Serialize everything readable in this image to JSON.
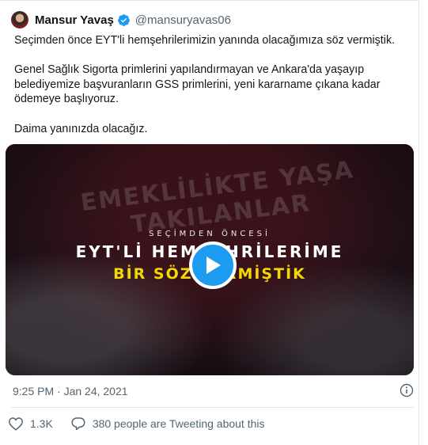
{
  "tweet": {
    "author": {
      "display_name": "Mansur Yavaş",
      "handle": "@mansuryavas06",
      "verified": true
    },
    "paragraphs": [
      "Seçimden önce EYT'li hemşehrilerimizin yanında olacağımıza söz vermiştik.",
      "Genel Sağlık Sigorta primlerini yapılandırmayan ve Ankara'da yaşayıp\nbelediyemize başvuranların GSS primlerini, yeni kararname çıkana kadar\nödemeye başlıyoruz.",
      "Daima yanınızda olacağız."
    ],
    "timestamp": "9:25 PM · Jan 24, 2021",
    "likes": "1.3K",
    "conversation": "380 people are Tweeting about this"
  },
  "video": {
    "banner_text": "EMEKLİLİKTE YAŞA TAKILANLAR",
    "line1": "SEÇİMDEN ÖNCESİ",
    "line2": "EYT'Lİ HEMŞEHRİLERİME",
    "line3": "BİR SÖZ VERMİŞTİK"
  },
  "colors": {
    "accent": "#1d9bf0",
    "secondary_text": "#536471",
    "highlight_yellow": "#f5d800"
  },
  "icons": {
    "verified": "verified-badge-icon",
    "play": "play-icon",
    "info": "info-icon",
    "like": "heart-icon",
    "conversation": "speech-bubble-icon"
  }
}
